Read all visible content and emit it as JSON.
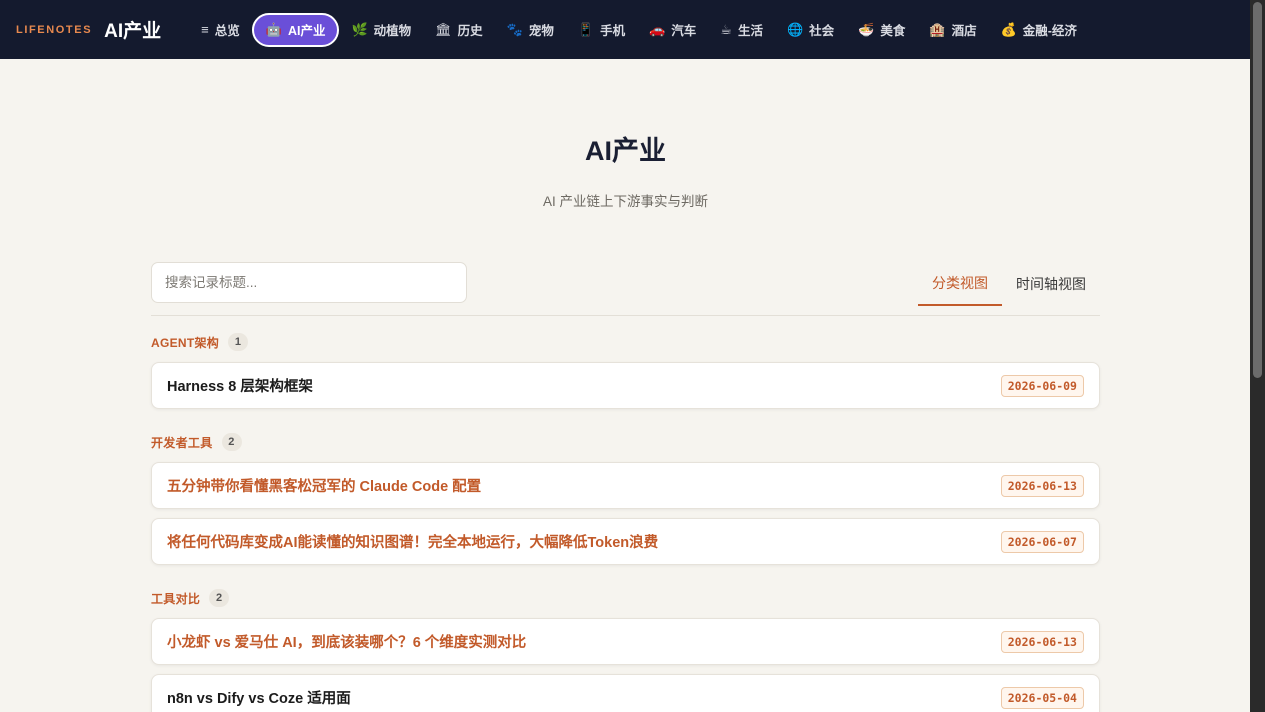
{
  "nav": {
    "brand": "LIFENOTES",
    "section": "AI产业",
    "items": [
      {
        "icon": "≡",
        "icon_name": "menu-icon",
        "label": "总览",
        "active": false
      },
      {
        "icon": "🤖",
        "icon_name": "robot-icon",
        "label": "AI产业",
        "active": true
      },
      {
        "icon": "🌿",
        "icon_name": "leaf-icon",
        "label": "动植物",
        "active": false
      },
      {
        "icon": "🏛",
        "icon_name": "museum-icon",
        "label": "历史",
        "active": false
      },
      {
        "icon": "🐾",
        "icon_name": "paw-icon",
        "label": "宠物",
        "active": false
      },
      {
        "icon": "📱",
        "icon_name": "phone-icon",
        "label": "手机",
        "active": false
      },
      {
        "icon": "🚗",
        "icon_name": "car-icon",
        "label": "汽车",
        "active": false
      },
      {
        "icon": "☕",
        "icon_name": "cup-icon",
        "label": "生活",
        "active": false
      },
      {
        "icon": "🌐",
        "icon_name": "globe-icon",
        "label": "社会",
        "active": false
      },
      {
        "icon": "🍜",
        "icon_name": "noodle-icon",
        "label": "美食",
        "active": false
      },
      {
        "icon": "🏨",
        "icon_name": "hotel-icon",
        "label": "酒店",
        "active": false
      },
      {
        "icon": "💰",
        "icon_name": "money-bag-icon",
        "label": "金融-经济",
        "active": false
      }
    ]
  },
  "header": {
    "title": "AI产业",
    "subtitle": "AI 产业链上下游事实与判断"
  },
  "search": {
    "placeholder": "搜索记录标题...",
    "value": ""
  },
  "view_tabs": [
    {
      "label": "分类视图",
      "active": true
    },
    {
      "label": "时间轴视图",
      "active": false
    }
  ],
  "categories": [
    {
      "name": "AGENT架构",
      "count": "1",
      "records": [
        {
          "title": "Harness 8 层架构框架",
          "date": "2026-06-09",
          "accent": false
        }
      ]
    },
    {
      "name": "开发者工具",
      "count": "2",
      "records": [
        {
          "title": "五分钟带你看懂黑客松冠军的 Claude Code 配置",
          "date": "2026-06-13",
          "accent": true
        },
        {
          "title": "将任何代码库变成AI能读懂的知识图谱！完全本地运行，大幅降低Token浪费",
          "date": "2026-06-07",
          "accent": true
        }
      ]
    },
    {
      "name": "工具对比",
      "count": "2",
      "records": [
        {
          "title": "小龙虾 vs 爱马仕 AI，到底该装哪个？6 个维度实测对比",
          "date": "2026-06-13",
          "accent": true
        },
        {
          "title": "n8n vs Dify vs Coze 适用面",
          "date": "2026-05-04",
          "accent": false
        }
      ]
    }
  ],
  "colors": {
    "nav_bg": "#141a2e",
    "accent": "#c25a2a",
    "active_pill": "#6a4fd8",
    "page_bg": "#f6f4ef"
  }
}
